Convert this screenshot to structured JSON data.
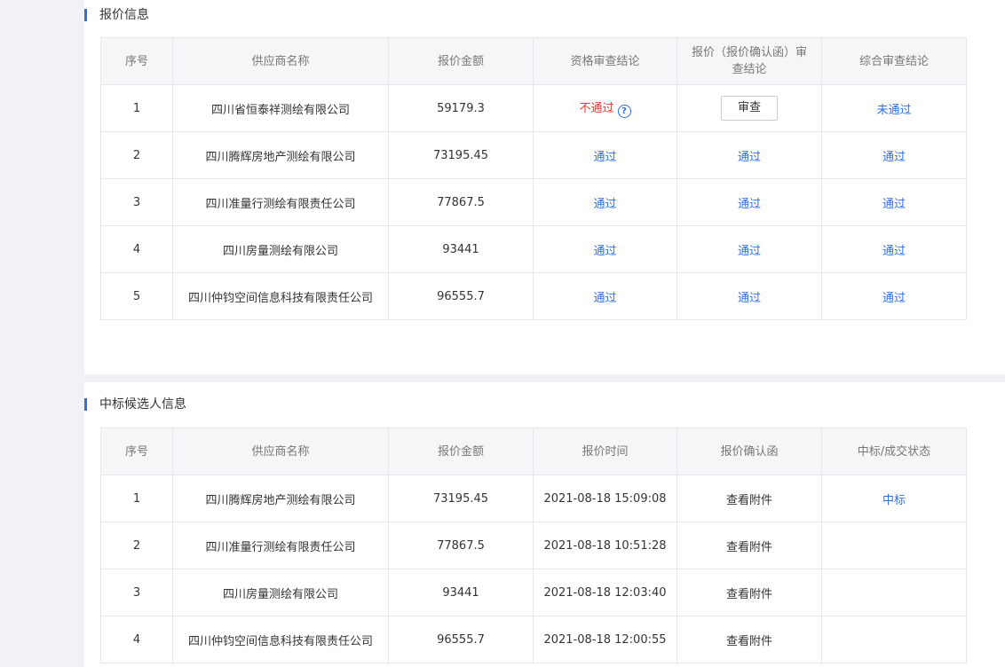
{
  "quote_section": {
    "title": "报价信息",
    "headers": [
      "序号",
      "供应商名称",
      "报价金额",
      "资格审查结论",
      "报价（报价确认函）审查结论",
      "综合审查结论"
    ],
    "rows": [
      {
        "no": "1",
        "supplier": "四川省恒泰祥测绘有限公司",
        "amount": "59179.3",
        "qualification": "不通过",
        "quote_review_button": "审查",
        "overall": "未通过"
      },
      {
        "no": "2",
        "supplier": "四川腾辉房地产测绘有限公司",
        "amount": "73195.45",
        "qualification": "通过",
        "quote_review": "通过",
        "overall": "通过"
      },
      {
        "no": "3",
        "supplier": "四川准量行测绘有限责任公司",
        "amount": "77867.5",
        "qualification": "通过",
        "quote_review": "通过",
        "overall": "通过"
      },
      {
        "no": "4",
        "supplier": "四川房量测绘有限公司",
        "amount": "93441",
        "qualification": "通过",
        "quote_review": "通过",
        "overall": "通过"
      },
      {
        "no": "5",
        "supplier": "四川仲钧空间信息科技有限责任公司",
        "amount": "96555.7",
        "qualification": "通过",
        "quote_review": "通过",
        "overall": "通过"
      }
    ]
  },
  "candidate_section": {
    "title": "中标候选人信息",
    "headers": [
      "序号",
      "供应商名称",
      "报价金额",
      "报价时间",
      "报价确认函",
      "中标/成交状态"
    ],
    "rows": [
      {
        "no": "1",
        "supplier": "四川腾辉房地产测绘有限公司",
        "amount": "73195.45",
        "time": "2021-08-18 15:09:08",
        "attachment": "查看附件",
        "status": "中标"
      },
      {
        "no": "2",
        "supplier": "四川准量行测绘有限责任公司",
        "amount": "77867.5",
        "time": "2021-08-18 10:51:28",
        "attachment": "查看附件",
        "status": ""
      },
      {
        "no": "3",
        "supplier": "四川房量测绘有限公司",
        "amount": "93441",
        "time": "2021-08-18 12:03:40",
        "attachment": "查看附件",
        "status": ""
      },
      {
        "no": "4",
        "supplier": "四川仲钧空间信息科技有限责任公司",
        "amount": "96555.7",
        "time": "2021-08-18 12:00:55",
        "attachment": "查看附件",
        "status": ""
      }
    ]
  },
  "icons": {
    "help": "question-circle-icon"
  },
  "colors": {
    "accent": "#2e6fe6",
    "fail": "#e53935",
    "header_bg": "#f5f6f8"
  }
}
